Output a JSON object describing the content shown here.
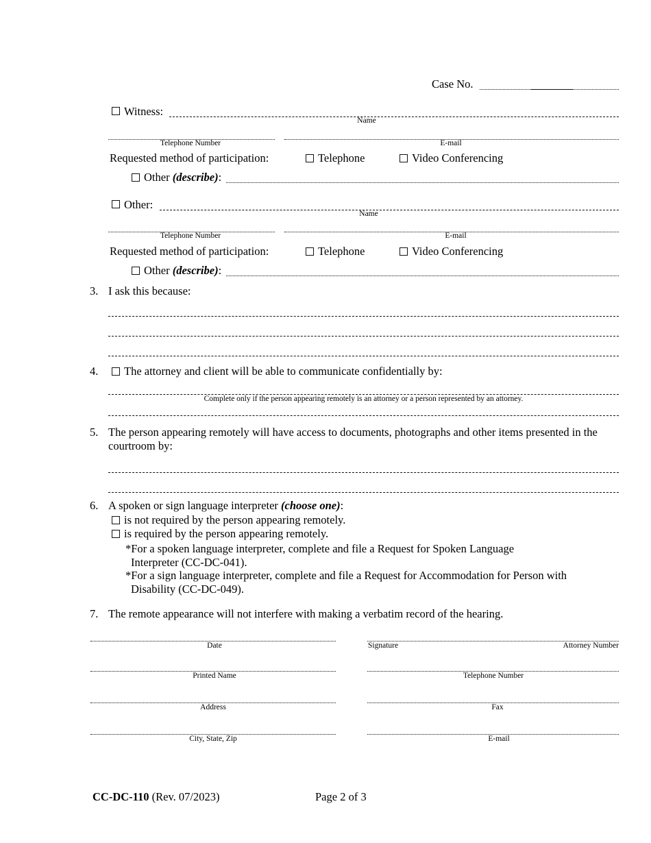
{
  "document": {
    "form_number": "CC-DC-110",
    "revision": "(Rev. 07/2023)",
    "page_label": "Page 2 of 3",
    "case_no_label": "Case No."
  },
  "participants": [
    {
      "checkbox_label": "Witness:",
      "name_caption": "Name",
      "telephone_caption": "Telephone Number",
      "email_caption": "E-mail",
      "method_label": "Requested method of participation:",
      "option_telephone": "Telephone",
      "option_video": "Video Conferencing",
      "other_label": "Other",
      "other_describe": "(describe)",
      "other_colon": ":"
    },
    {
      "checkbox_label": "Other:",
      "name_caption": "Name",
      "telephone_caption": "Telephone Number",
      "email_caption": "E-mail",
      "method_label": "Requested method of participation:",
      "option_telephone": "Telephone",
      "option_video": "Video Conferencing",
      "other_label": "Other",
      "other_describe": "(describe)",
      "other_colon": ":"
    }
  ],
  "items": {
    "item3": {
      "number": "3.",
      "text": "I ask this because:"
    },
    "item4": {
      "number": "4.",
      "text": "The attorney and client will be able to communicate confidentially by:",
      "caption": "Complete only if the person appearing remotely is an attorney or a person represented by an attorney."
    },
    "item5": {
      "number": "5.",
      "text": "The person appearing remotely will have access to documents, photographs and other items presented in the courtroom by:"
    },
    "item6": {
      "number": "6.",
      "text_before": "A spoken or sign language interpreter ",
      "text_emphasis": "(choose one)",
      "text_after": ":",
      "option_not_required": "is not required by the person appearing remotely.",
      "option_required": "is required by the person appearing remotely.",
      "note_spoken": "*For a spoken language interpreter, complete and file a Request for Spoken Language Interpreter (CC-DC-041).",
      "note_sign": "*For a sign language interpreter, complete and file a Request for Accommodation for Person with Disability (CC-DC-049)."
    },
    "item7": {
      "number": "7.",
      "text": "The remote appearance will not interfere with making a verbatim record of the hearing."
    }
  },
  "signature_block": {
    "date": "Date",
    "signature": "Signature",
    "attorney_number": "Attorney Number",
    "printed_name": "Printed Name",
    "telephone_number": "Telephone Number",
    "address": "Address",
    "fax": "Fax",
    "city_state_zip": "City, State, Zip",
    "email": "E-mail"
  }
}
